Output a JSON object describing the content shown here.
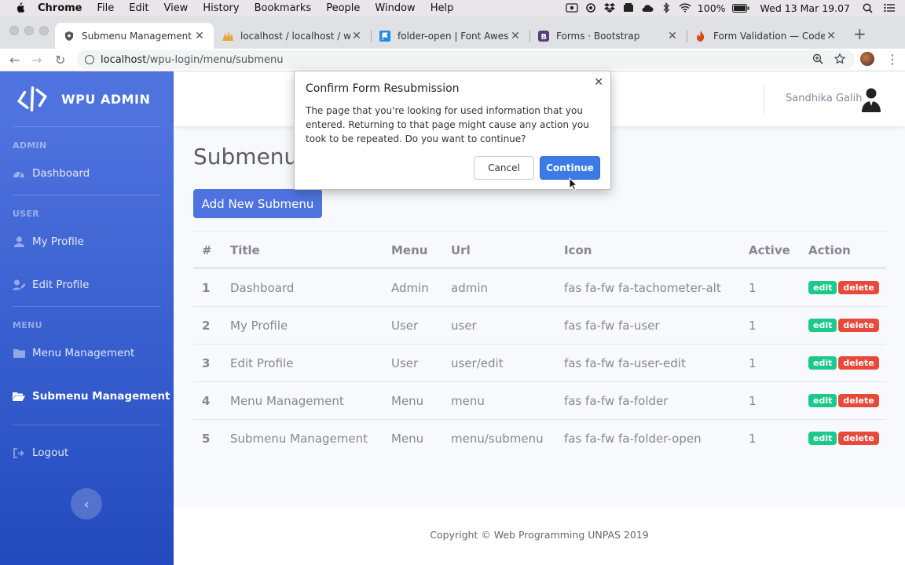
{
  "menubar": {
    "app": "Chrome",
    "items": [
      "File",
      "Edit",
      "View",
      "History",
      "Bookmarks",
      "People",
      "Window",
      "Help"
    ],
    "battery": "100%",
    "datetime": "Wed 13 Mar  19.07"
  },
  "tabs": [
    {
      "title": "Submenu Management",
      "icon": "shield-icon",
      "active": true
    },
    {
      "title": "localhost / localhost / wpu_lo",
      "icon": "phpmyadmin-icon"
    },
    {
      "title": "folder-open | Font Awesome",
      "icon": "flag-icon"
    },
    {
      "title": "Forms · Bootstrap",
      "icon": "bootstrap-icon"
    },
    {
      "title": "Form Validation — CodeIgniter",
      "icon": "flame-icon"
    }
  ],
  "address": {
    "host": "localhost",
    "path": "/wpu-login/menu/submenu"
  },
  "brand": "WPU ADMIN",
  "sidebar": {
    "headings": {
      "admin": "ADMIN",
      "user": "USER",
      "menu": "MENU"
    },
    "items": {
      "dashboard": "Dashboard",
      "my_profile": "My Profile",
      "edit_profile": "Edit Profile",
      "menu_management": "Menu Management",
      "submenu_management": "Submenu Management",
      "logout": "Logout"
    }
  },
  "topbar": {
    "username": "Sandhika Galih"
  },
  "main": {
    "title": "Submenu Management",
    "add_button": "Add New Submenu",
    "columns": [
      "#",
      "Title",
      "Menu",
      "Url",
      "Icon",
      "Active",
      "Action"
    ],
    "rows": [
      [
        "1",
        "Dashboard",
        "Admin",
        "admin",
        "fas fa-fw fa-tachometer-alt",
        "1"
      ],
      [
        "2",
        "My Profile",
        "User",
        "user",
        "fas fa-fw fa-user",
        "1"
      ],
      [
        "3",
        "Edit Profile",
        "User",
        "user/edit",
        "fas fa-fw fa-user-edit",
        "1"
      ],
      [
        "4",
        "Menu Management",
        "Menu",
        "menu",
        "fas fa-fw fa-folder",
        "1"
      ],
      [
        "5",
        "Submenu Management",
        "Menu",
        "menu/submenu",
        "fas fa-fw fa-folder-open",
        "1"
      ]
    ],
    "edit_label": "edit",
    "delete_label": "delete"
  },
  "footer": {
    "copyright": "Copyright © Web Programming UNPAS 2019"
  },
  "dialog": {
    "title": "Confirm Form Resubmission",
    "body": "The page that you're looking for used information that you entered. Returning to that page might cause any action you took to be repeated. Do you want to continue?",
    "cancel": "Cancel",
    "continue": "Continue"
  },
  "colors": {
    "primary": "#4e73df",
    "sidebar_end": "#224abe",
    "success": "#1cc88a",
    "danger": "#e74a3b"
  }
}
